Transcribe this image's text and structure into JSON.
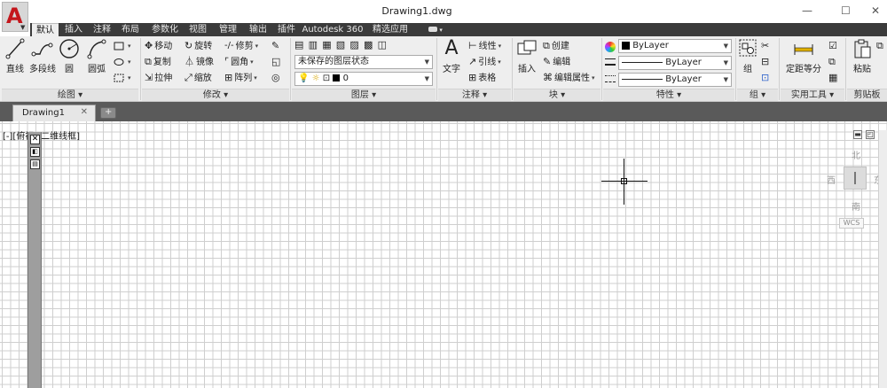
{
  "window": {
    "title": "Drawing1.dwg",
    "app_logo": "A",
    "minimize": "—",
    "maximize": "☐",
    "close": "✕"
  },
  "tabs": [
    "默认",
    "插入",
    "注释",
    "布局",
    "参数化",
    "视图",
    "管理",
    "输出",
    "插件",
    "Autodesk 360",
    "精选应用"
  ],
  "draw": {
    "line": "直线",
    "polyline": "多段线",
    "circle": "圆",
    "arc": "圆弧",
    "panel": "绘图 ▾"
  },
  "modify": {
    "move": "移动",
    "rotate": "旋转",
    "trim": "修剪",
    "copy": "复制",
    "mirror": "镜像",
    "fillet": "圆角",
    "stretch": "拉伸",
    "scale": "缩放",
    "array": "阵列",
    "panel": "修改 ▾"
  },
  "layers": {
    "state": "未保存的图层状态",
    "current": "0",
    "panel": "图层 ▾"
  },
  "annotation": {
    "text": "文字",
    "linear": "线性",
    "leader": "引线",
    "table": "表格",
    "panel": "注释 ▾"
  },
  "block": {
    "insert": "插入",
    "create": "创建",
    "edit": "编辑",
    "edit_attr": "编辑属性",
    "panel": "块 ▾"
  },
  "properties": {
    "color": "ByLayer",
    "linetype": "ByLayer",
    "lineweight": "ByLayer",
    "panel": "特性 ▾"
  },
  "groups": {
    "group": "组",
    "panel": "组 ▾"
  },
  "utilities": {
    "measure": "定距等分",
    "panel": "实用工具 ▾"
  },
  "clipboard": {
    "paste": "粘贴",
    "panel": "剪贴板"
  },
  "file_tab": {
    "name": "Drawing1",
    "close": "✕"
  },
  "viewport": {
    "label": "[-][俯视][二维线框]",
    "north": "北",
    "south": "南",
    "east": "东",
    "west": "西",
    "wcs": "WCS"
  },
  "colors": {
    "accent": "#c4161c",
    "tabbar": "#3b3b3b",
    "ribbon": "#eeeeee",
    "grid": "#cfcfcf"
  }
}
